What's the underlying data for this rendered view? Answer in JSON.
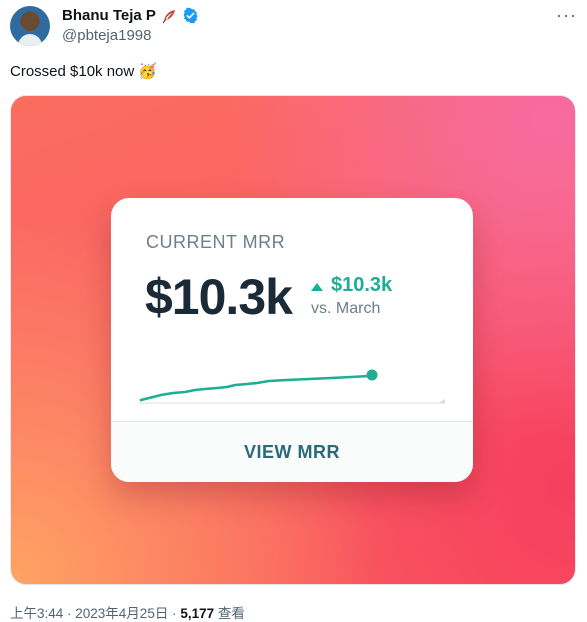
{
  "author": {
    "name": "Bhanu Teja P",
    "handle": "@pbteja1998"
  },
  "tweet": {
    "text": "Crossed $10k now 🥳"
  },
  "card": {
    "label": "CURRENT MRR",
    "value": "$10.3k",
    "delta_value": "$10.3k",
    "comparison": "vs. March",
    "button": "VIEW MRR",
    "accent_color": "#1dae93"
  },
  "footer": {
    "timestamp": "上午3:44 · 2023年4月25日 · ",
    "views": "5,177",
    "views_label": " 查看"
  }
}
